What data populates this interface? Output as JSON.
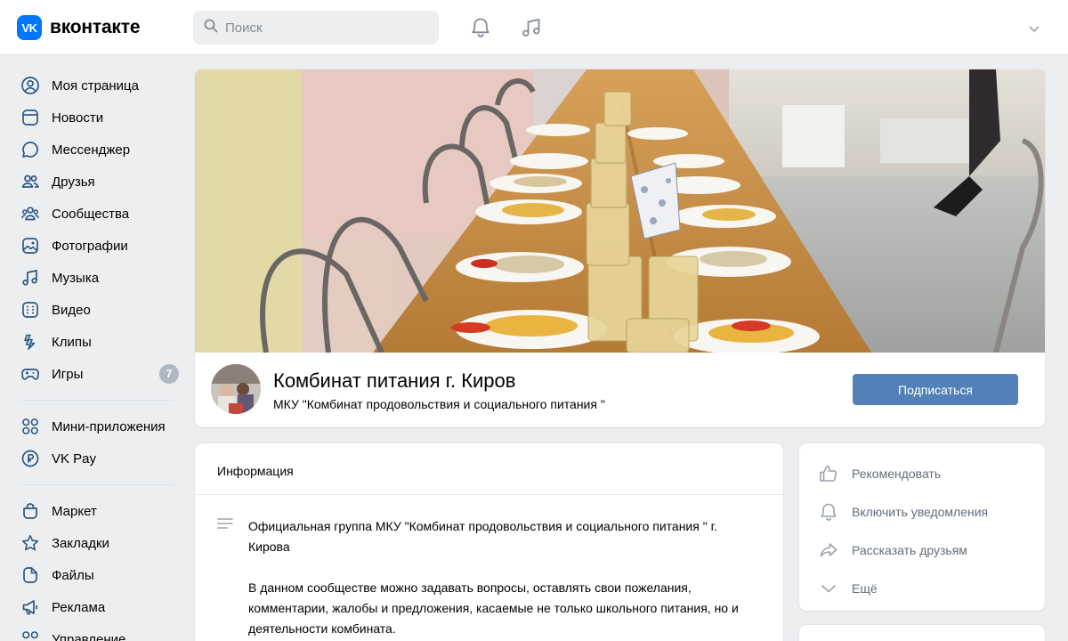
{
  "header": {
    "logo_mark": "VK",
    "logo_text": "вконтакте",
    "search_placeholder": "Поиск",
    "icons": [
      "bell-icon",
      "music-note-icon",
      "chevron-down-icon"
    ]
  },
  "sidebar": {
    "groups": [
      [
        {
          "label": "Моя страница",
          "icon": "user-circle-icon"
        },
        {
          "label": "Новости",
          "icon": "news-icon"
        },
        {
          "label": "Мессенджер",
          "icon": "message-bubble-icon"
        },
        {
          "label": "Друзья",
          "icon": "friends-icon"
        },
        {
          "label": "Сообщества",
          "icon": "communities-icon"
        },
        {
          "label": "Фотографии",
          "icon": "photo-icon"
        },
        {
          "label": "Музыка",
          "icon": "music-icon"
        },
        {
          "label": "Видео",
          "icon": "video-icon"
        },
        {
          "label": "Клипы",
          "icon": "clips-icon"
        },
        {
          "label": "Игры",
          "icon": "gamepad-icon",
          "badge": "7"
        }
      ],
      [
        {
          "label": "Мини-приложения",
          "icon": "mini-apps-icon"
        },
        {
          "label": "VK Pay",
          "icon": "vk-pay-icon"
        }
      ],
      [
        {
          "label": "Маркет",
          "icon": "shopping-bag-icon"
        },
        {
          "label": "Закладки",
          "icon": "star-icon"
        },
        {
          "label": "Файлы",
          "icon": "file-icon"
        },
        {
          "label": "Реклама",
          "icon": "megaphone-icon"
        },
        {
          "label": "Управление",
          "icon": "manage-icon"
        }
      ]
    ]
  },
  "group": {
    "name": "Комбинат питания г. Киров",
    "status": "МКУ \"Комбинат продовольствия и социального питания \"",
    "subscribe_label": "Подписаться"
  },
  "info": {
    "title": "Информация",
    "paragraph_1": "Официальная группа МКУ \"Комбинат продовольствия и социального питания \" г. Кирова",
    "paragraph_2": "В данном сообществе можно задавать вопросы, оставлять свои пожелания, комментарии, жалобы и предложения, касаемые не только школьного питания, но и деятельности комбината."
  },
  "actions": [
    {
      "label": "Рекомендовать",
      "icon": "thumbs-up-icon"
    },
    {
      "label": "Включить уведомления",
      "icon": "bell-icon"
    },
    {
      "label": "Рассказать друзьям",
      "icon": "share-arrow-icon"
    },
    {
      "label": "Ещё",
      "icon": "chevron-down-icon"
    }
  ],
  "colors": {
    "accent": "#0077ff",
    "button": "#5181b8",
    "icon": "#2a5885",
    "muted": "#818c99",
    "background": "#edeef0"
  }
}
